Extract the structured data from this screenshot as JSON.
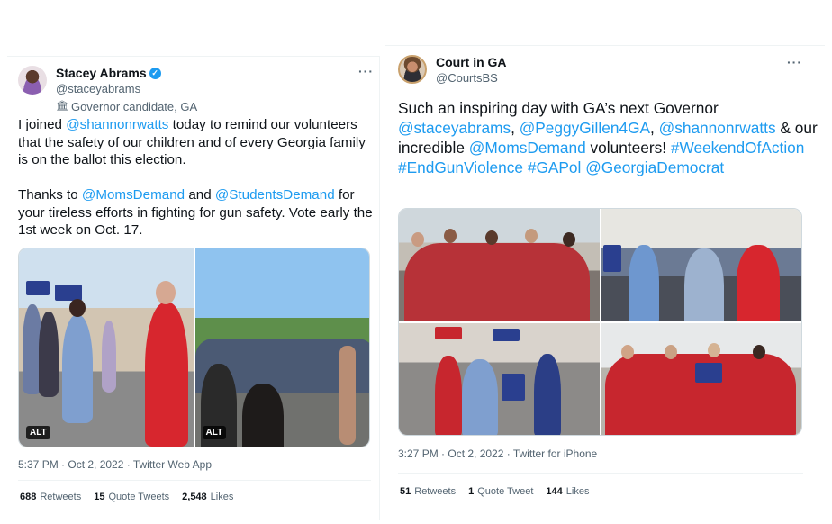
{
  "tweets": [
    {
      "display_name": "Stacey Abrams",
      "handle": "@staceyabrams",
      "label": "Governor candidate, GA",
      "body": [
        [
          {
            "t": "I joined ",
            "link": false
          },
          {
            "t": "@shannonrwatts",
            "link": true
          },
          {
            "t": " today to remind our volunteers that the safety of our children and of every Georgia family is on the ballot this election.",
            "link": false
          }
        ],
        [
          {
            "t": "Thanks to ",
            "link": false
          },
          {
            "t": "@MomsDemand",
            "link": true
          },
          {
            "t": " and ",
            "link": false
          },
          {
            "t": "@StudentsDemand",
            "link": true
          },
          {
            "t": " for your tireless efforts in fighting for gun safety. Vote early the 1st week on Oct. 17.",
            "link": false
          }
        ]
      ],
      "alt_badges": [
        "ALT",
        "ALT"
      ],
      "timestamp": "5:37 PM · Oct 2, 2022 · Twitter Web App",
      "stats": [
        {
          "value": "688",
          "label": "Retweets"
        },
        {
          "value": "15",
          "label": "Quote Tweets"
        },
        {
          "value": "2,548",
          "label": "Likes"
        }
      ]
    },
    {
      "display_name": "Court in GA",
      "handle": "@CourtsBS",
      "body": [
        [
          {
            "t": "Such an inspiring day with GA’s next Governor ",
            "link": false
          },
          {
            "t": "@staceyabrams",
            "link": true
          },
          {
            "t": ", ",
            "link": false
          },
          {
            "t": "@PeggyGillen4GA",
            "link": true
          },
          {
            "t": ", ",
            "link": false
          },
          {
            "t": "@shannonrwatts",
            "link": true
          },
          {
            "t": " & our incredible ",
            "link": false
          },
          {
            "t": "@MomsDemand",
            "link": true
          },
          {
            "t": " volunteers! ",
            "link": false
          },
          {
            "t": "#WeekendOfAction",
            "link": true
          },
          {
            "t": " ",
            "link": false
          },
          {
            "t": "#EndGunViolence",
            "link": true
          },
          {
            "t": " ",
            "link": false
          },
          {
            "t": "#GAPol",
            "link": true
          },
          {
            "t": " ",
            "link": false
          },
          {
            "t": "@GeorgiaDemocrat",
            "link": true
          }
        ]
      ],
      "timestamp": "3:27 PM · Oct 2, 2022 · Twitter for iPhone",
      "stats": [
        {
          "value": "51",
          "label": "Retweets"
        },
        {
          "value": "1",
          "label": "Quote Tweet"
        },
        {
          "value": "144",
          "label": "Likes"
        }
      ]
    }
  ],
  "icons": {
    "verified": "verified-badge-icon",
    "label": "government-building-icon",
    "more": "more-options-icon"
  },
  "colors": {
    "link": "#1d9bf0",
    "text": "#0f1419",
    "secondary": "#536471"
  }
}
